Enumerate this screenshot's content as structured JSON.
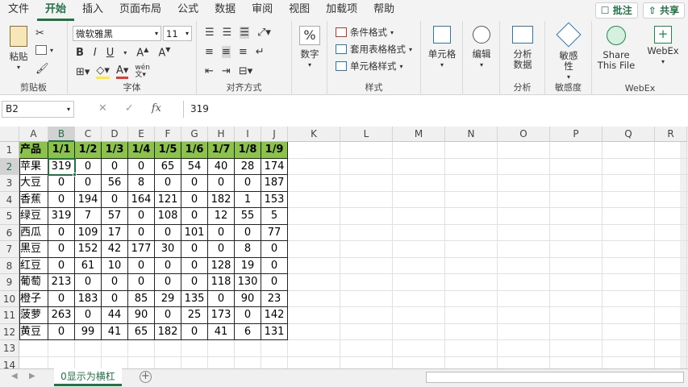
{
  "menu": {
    "tabs": [
      "文件",
      "开始",
      "插入",
      "页面布局",
      "公式",
      "数据",
      "审阅",
      "视图",
      "加载项",
      "帮助"
    ],
    "active": "开始",
    "comment_btn": "批注",
    "share_btn": "共享"
  },
  "ribbon": {
    "clipboard": {
      "paste": "粘贴",
      "label": "剪贴板"
    },
    "font": {
      "name": "微软雅黑",
      "size": "11",
      "label": "字体",
      "phonetic": "wén"
    },
    "alignment": {
      "label": "对齐方式"
    },
    "number": {
      "label": "数字",
      "icon": "%"
    },
    "styles": {
      "cond_format": "条件格式",
      "table_format": "套用表格格式",
      "cell_style": "单元格样式",
      "label": "样式"
    },
    "cells": {
      "label": "单元格"
    },
    "editing": {
      "label": "编辑"
    },
    "analysis": {
      "btn": "分析\n数据",
      "label": "分析"
    },
    "sensitivity": {
      "btn": "敏感\n性",
      "label": "敏感度"
    },
    "webex": {
      "share": "Share\nThis File",
      "webex": "WebEx",
      "label": "WebEx"
    }
  },
  "formula_bar": {
    "name_box": "B2",
    "value": "319",
    "fx": "fx"
  },
  "columns": [
    "A",
    "B",
    "C",
    "D",
    "E",
    "F",
    "G",
    "H",
    "I",
    "J",
    "K",
    "L",
    "M",
    "N",
    "O",
    "P",
    "Q",
    "R"
  ],
  "rows": [
    "1",
    "2",
    "3",
    "4",
    "5",
    "6",
    "7",
    "8",
    "9",
    "10",
    "11",
    "12",
    "13",
    "14"
  ],
  "table": {
    "header": [
      "产品",
      "1/1",
      "1/2",
      "1/3",
      "1/4",
      "1/5",
      "1/6",
      "1/7",
      "1/8",
      "1/9"
    ],
    "body": [
      [
        "苹果",
        "319",
        "0",
        "0",
        "0",
        "65",
        "54",
        "40",
        "28",
        "174"
      ],
      [
        "大豆",
        "0",
        "0",
        "56",
        "8",
        "0",
        "0",
        "0",
        "0",
        "187"
      ],
      [
        "香蕉",
        "0",
        "194",
        "0",
        "164",
        "121",
        "0",
        "182",
        "1",
        "153"
      ],
      [
        "绿豆",
        "319",
        "7",
        "57",
        "0",
        "108",
        "0",
        "12",
        "55",
        "5"
      ],
      [
        "西瓜",
        "0",
        "109",
        "17",
        "0",
        "0",
        "101",
        "0",
        "0",
        "77"
      ],
      [
        "黑豆",
        "0",
        "152",
        "42",
        "177",
        "30",
        "0",
        "0",
        "8",
        "0"
      ],
      [
        "红豆",
        "0",
        "61",
        "10",
        "0",
        "0",
        "0",
        "128",
        "19",
        "0"
      ],
      [
        "葡萄",
        "213",
        "0",
        "0",
        "0",
        "0",
        "0",
        "118",
        "130",
        "0"
      ],
      [
        "橙子",
        "0",
        "183",
        "0",
        "85",
        "29",
        "135",
        "0",
        "90",
        "23"
      ],
      [
        "菠萝",
        "263",
        "0",
        "44",
        "90",
        "0",
        "25",
        "173",
        "0",
        "142"
      ],
      [
        "黄豆",
        "0",
        "99",
        "41",
        "65",
        "182",
        "0",
        "41",
        "6",
        "131"
      ]
    ]
  },
  "sheet_tab": "0显示为横杠",
  "colors": {
    "accent": "#217346",
    "header_fill": "#8bc34a"
  }
}
